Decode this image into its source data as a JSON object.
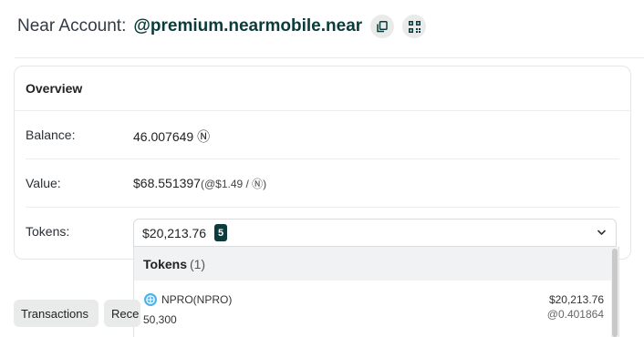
{
  "header": {
    "label": "Near Account:",
    "account": "@premium.nearmobile.near",
    "copy_icon": "copy-icon",
    "qr_icon": "qr-code-icon"
  },
  "overview": {
    "title": "Overview",
    "balance_label": "Balance:",
    "balance_value": "46.007649 Ⓝ",
    "value_label": "Value:",
    "value_amount": "$68.551397",
    "value_rate": "(@$1.49 / Ⓝ)",
    "tokens_label": "Tokens:",
    "tokens_total": "$20,213.76",
    "tokens_count": "5"
  },
  "dropdown": {
    "header": "Tokens",
    "header_count": "(1)",
    "items": [
      {
        "name": "NPRO(NPRO)",
        "amount": "50,300",
        "usd": "$20,213.76",
        "price": "@0.401864",
        "icon": "npro-token-icon"
      }
    ]
  },
  "tabs": [
    {
      "label": "Transactions"
    },
    {
      "label": "Rece"
    }
  ],
  "colors": {
    "accent": "#0b3b3a",
    "badge_bg": "#0b3b3a",
    "chip_bg": "#e8ebea"
  }
}
